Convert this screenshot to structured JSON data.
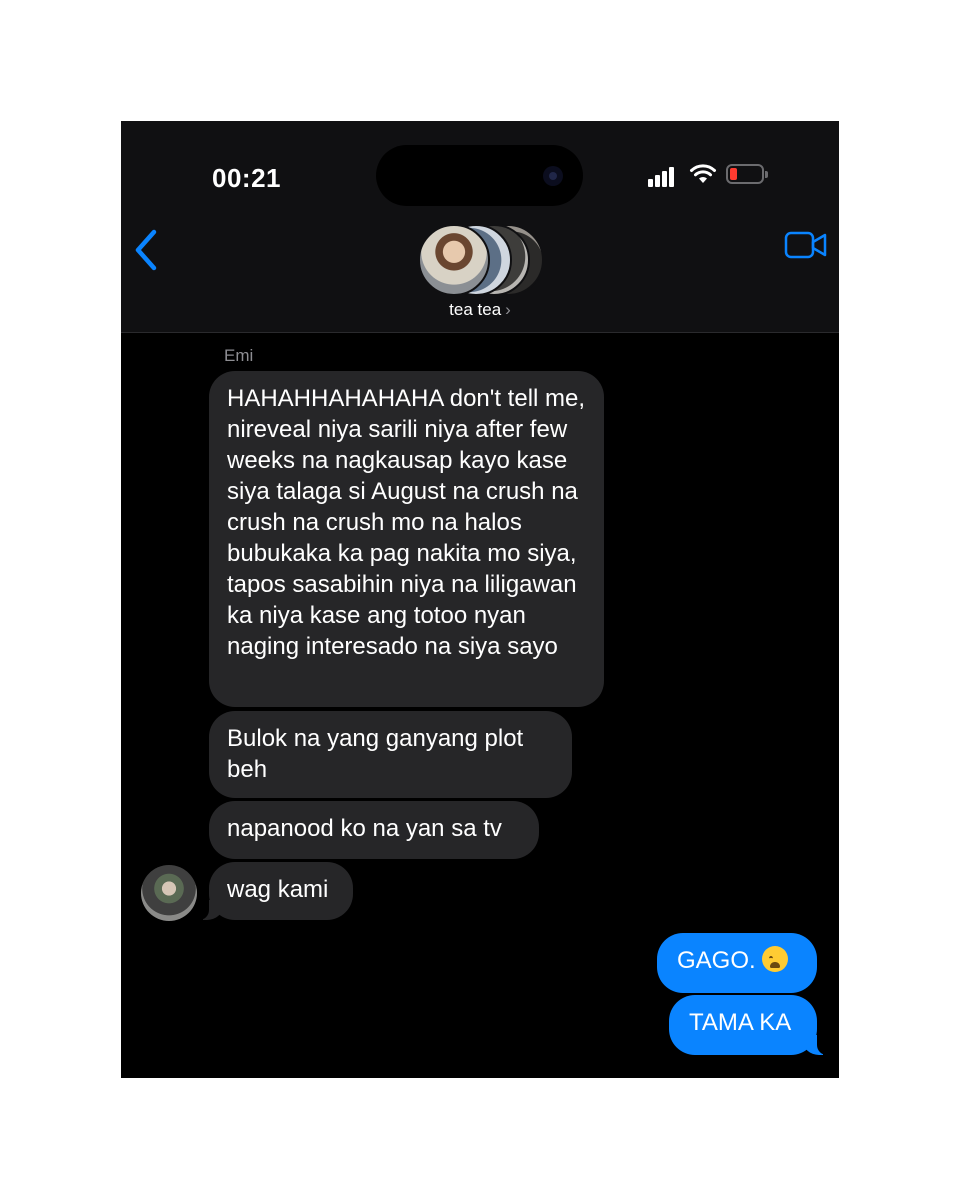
{
  "status": {
    "time": "00:21"
  },
  "header": {
    "group_name": "tea tea",
    "chevron": "›"
  },
  "messages": {
    "sender": "Emi",
    "incoming": [
      "HAHAHHAHAHAHA don't tell me, nireveal niya sarili niya after few weeks na nagkausap kayo kase siya talaga si August na crush na crush na crush mo na halos bubukaka ka pag nakita mo siya, tapos sasabihin niya na liligawan ka niya kase ang totoo nyan naging interesado na siya sayo",
      "Bulok na yang ganyang plot beh",
      "napanood ko na yan sa tv",
      "wag kami"
    ],
    "outgoing": [
      {
        "text": "GAGO.",
        "emoji": "crying-face-emoji"
      },
      {
        "text": "TAMA KA"
      }
    ]
  },
  "colors": {
    "background": "#000000",
    "incoming_bubble": "#262628",
    "outgoing_bubble": "#0a84ff",
    "accent": "#0a84ff"
  },
  "icons": [
    "back-chevron-icon",
    "video-camera-icon",
    "signal-icon",
    "wifi-icon",
    "battery-icon"
  ]
}
